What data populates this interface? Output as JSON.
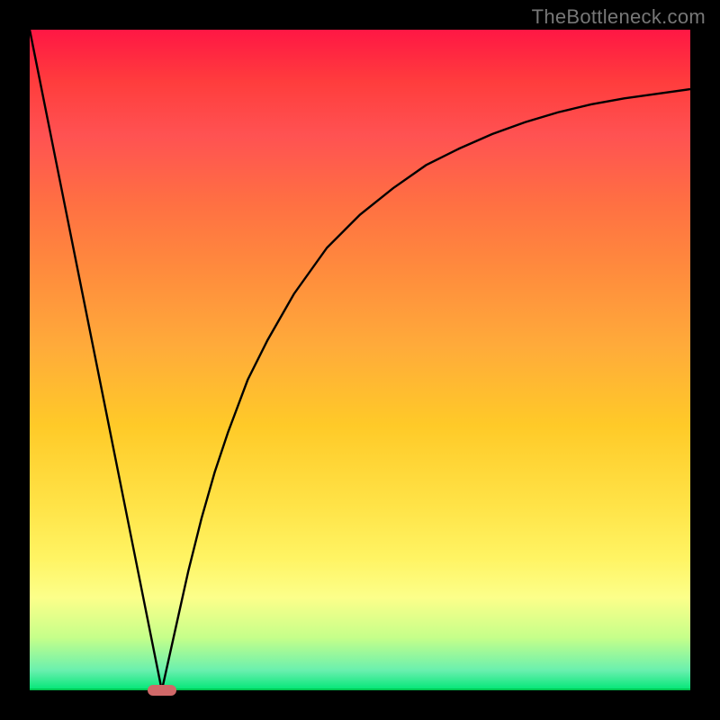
{
  "watermark": "TheBottleneck.com",
  "chart_data": {
    "type": "line",
    "title": "",
    "xlabel": "",
    "ylabel": "",
    "xlim": [
      0,
      100
    ],
    "ylim": [
      0,
      100
    ],
    "grid": false,
    "legend": false,
    "minimum_x_pct": 20,
    "series": [
      {
        "name": "bottleneck-curve",
        "x": [
          0,
          2,
          4,
          6,
          8,
          10,
          12,
          14,
          16,
          18,
          20,
          22,
          24,
          26,
          28,
          30,
          33,
          36,
          40,
          45,
          50,
          55,
          60,
          65,
          70,
          75,
          80,
          85,
          90,
          95,
          100
        ],
        "values": [
          100,
          90,
          80,
          70,
          60,
          50,
          40,
          30,
          20,
          10,
          0,
          9,
          18,
          26,
          33,
          39,
          47,
          53,
          60,
          67,
          72,
          76,
          79.5,
          82,
          84.2,
          86,
          87.5,
          88.7,
          89.6,
          90.3,
          91
        ]
      }
    ],
    "marker": {
      "x_pct": 20,
      "label": ""
    },
    "colors": {
      "gradient_top": "#ff1744",
      "gradient_bottom": "#00e676",
      "curve": "#000000",
      "marker": "#d06868"
    }
  }
}
